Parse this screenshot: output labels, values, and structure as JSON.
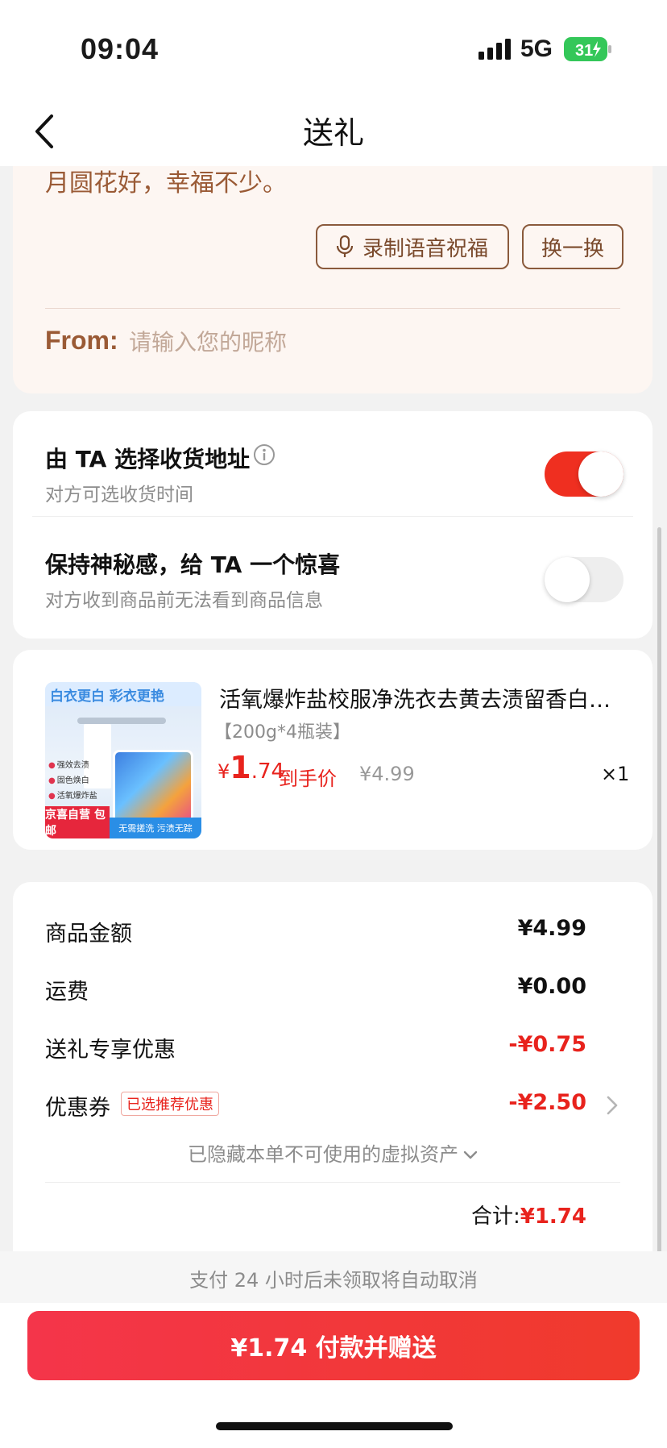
{
  "status_bar": {
    "time": "09:04",
    "network": "5G",
    "battery": "31",
    "icons": [
      "signal-bars-icon",
      "battery-charging-icon"
    ]
  },
  "header": {
    "title": "送礼",
    "back_icon": "chevron-left-icon"
  },
  "message": {
    "text": "月圆花好，幸福不少。",
    "voice_button": "录制语音祝福",
    "swap_button": "换一换",
    "from_label": "From:",
    "from_placeholder": "请输入您的昵称"
  },
  "options": [
    {
      "title": "由 TA 选择收货地址",
      "subtitle": "对方可选收货时间",
      "enabled": true
    },
    {
      "title": "保持神秘感，给 TA 一个惊喜",
      "subtitle": "对方收到商品前无法看到商品信息",
      "enabled": false
    }
  ],
  "product": {
    "image": {
      "headline": "白衣更白 彩衣更艳",
      "bullets": [
        "强效去渍",
        "固色焕白",
        "活氧爆炸盐"
      ],
      "badge": "京喜自营 包邮",
      "strip": "无需搓洗 污渍无踪"
    },
    "name": "活氧爆炸盐校服净洗衣去黄去渍留香白…",
    "spec": "【200g*4瓶装】",
    "price_currency": "¥",
    "price_int": "1",
    "price_dec": ".74",
    "price_tag": "到手价",
    "original_price": "¥4.99",
    "quantity": "×1"
  },
  "summary": {
    "rows": [
      {
        "label": "商品金额",
        "value": "¥4.99",
        "red": false
      },
      {
        "label": "运费",
        "value": "¥0.00",
        "red": false
      },
      {
        "label": "送礼专享优惠",
        "value": "-¥0.75",
        "red": true
      },
      {
        "label": "优惠券",
        "value": "-¥2.50",
        "red": true,
        "tag": "已选推荐优惠"
      }
    ],
    "hidden_note": "已隐藏本单不可使用的虚拟资产",
    "total_label": "合计:",
    "total_value": "¥1.74"
  },
  "bottom": {
    "notice": "支付 24 小时后未领取将自动取消",
    "pay_button": "¥1.74 付款并赠送"
  },
  "colors": {
    "accent_red": "#e8231d",
    "toggle_on": "#ef2f20",
    "message_bg": "#fdf6f2",
    "brown": "#9a5a35"
  }
}
